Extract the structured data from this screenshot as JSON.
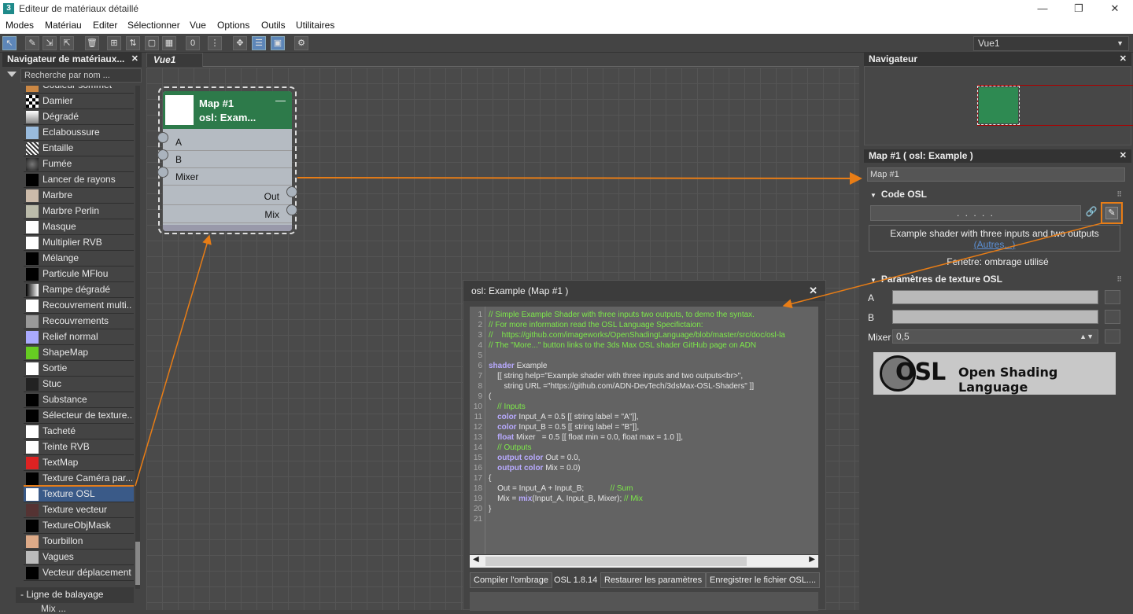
{
  "window": {
    "title": "Editeur de matériaux détaillé",
    "app_icon": "3",
    "controls": {
      "minimize": "—",
      "maximize": "❐",
      "close": "✕"
    }
  },
  "menu": [
    "Modes",
    "Matériau",
    "Editer",
    "Sélectionner",
    "Vue",
    "Options",
    "Outils",
    "Utilitaires"
  ],
  "toolbar": {
    "view_selector": "Vue1"
  },
  "left_panel": {
    "title": "Navigateur de matériaux...",
    "search_placeholder": "Recherche par nom ...",
    "items": [
      {
        "label": "Couleur sommet",
        "swatch": "#c84"
      },
      {
        "label": "Damier",
        "swatch": "checker"
      },
      {
        "label": "Dégradé",
        "swatch": "gradient"
      },
      {
        "label": "Eclaboussure",
        "swatch": "#9bd"
      },
      {
        "label": "Entaille",
        "swatch": "noise"
      },
      {
        "label": "Fumée",
        "swatch": "smoke"
      },
      {
        "label": "Lancer de rayons",
        "swatch": "#000"
      },
      {
        "label": "Marbre",
        "swatch": "#cba"
      },
      {
        "label": "Marbre Perlin",
        "swatch": "#bba"
      },
      {
        "label": "Masque",
        "swatch": "#fff"
      },
      {
        "label": "Multiplier RVB",
        "swatch": "#fff"
      },
      {
        "label": "Mélange",
        "swatch": "#000"
      },
      {
        "label": "Particule MFlou",
        "swatch": "#000"
      },
      {
        "label": "Rampe dégradé",
        "swatch": "ramp"
      },
      {
        "label": "Recouvrement multi...",
        "swatch": "#fff"
      },
      {
        "label": "Recouvrements",
        "swatch": "#999"
      },
      {
        "label": "Relief normal",
        "swatch": "#aaf"
      },
      {
        "label": "ShapeMap",
        "swatch": "#6c2"
      },
      {
        "label": "Sortie",
        "swatch": "#fff"
      },
      {
        "label": "Stuc",
        "swatch": "#222"
      },
      {
        "label": "Substance",
        "swatch": "#000"
      },
      {
        "label": "Sélecteur de texture...",
        "swatch": "#000"
      },
      {
        "label": "Tacheté",
        "swatch": "#fff"
      },
      {
        "label": "Teinte RVB",
        "swatch": "#fff"
      },
      {
        "label": "TextMap",
        "swatch": "#d22"
      },
      {
        "label": "Texture Caméra par...",
        "swatch": "#000"
      },
      {
        "label": "Texture OSL",
        "swatch": "#fff",
        "selected": true
      },
      {
        "label": "Texture vecteur",
        "swatch": "#533"
      },
      {
        "label": "TextureObjMask",
        "swatch": "#000"
      },
      {
        "label": "Tourbillon",
        "swatch": "#da8"
      },
      {
        "label": "Vagues",
        "swatch": "#bbb"
      },
      {
        "label": "Vecteur déplacement",
        "swatch": "#000"
      }
    ],
    "rollup": "- Ligne de balayage",
    "rollup_next": "Mix ..."
  },
  "view": {
    "tab": "Vue1"
  },
  "node": {
    "title1": "Map #1",
    "title2": "osl: Exam...",
    "minimize": "—",
    "inputs": [
      "A",
      "B",
      "Mixer"
    ],
    "outputs": [
      "Out",
      "Mix"
    ]
  },
  "navigator": {
    "title": "Navigateur",
    "close": "✕"
  },
  "map_panel": {
    "title": "Map #1  ( osl: Example )",
    "close": "✕",
    "name_field": "Map #1",
    "osl_section": "Code OSL",
    "dots_button": ". . . . .",
    "description": "Example shader with three inputs and two outputs",
    "more_link": "(Autres...)",
    "window_status": "Fenetre: ombrage utilisé",
    "params_section": "Paramètres de texture OSL",
    "params": [
      {
        "label": "A"
      },
      {
        "label": "B"
      }
    ],
    "mixer_label": "Mixer",
    "mixer_value": "0,5",
    "logo_text": "Open Shading Language",
    "logo_mark": "OSL"
  },
  "editor": {
    "title": "osl: Example (Map #1 )",
    "close": "✕",
    "line_numbers": [
      "1",
      "2",
      "3",
      "4",
      "5",
      "6",
      "7",
      "8",
      "9",
      "10",
      "11",
      "12",
      "13",
      "14",
      "15",
      "16",
      "17",
      "18",
      "19",
      "20",
      "21"
    ],
    "code": [
      [
        {
          "t": "// Simple Example Shader with three inputs two outputs, to demo the syntax.",
          "c": "cm"
        }
      ],
      [
        {
          "t": "// For more information read the OSL Language Specifictaion:",
          "c": "cm"
        }
      ],
      [
        {
          "t": "//    https://github.com/imageworks/OpenShadingLanguage/blob/master/src/doc/osl-la",
          "c": "cm"
        }
      ],
      [
        {
          "t": "// The \"More...\" button links to the 3ds Max OSL shader GitHub page on ADN",
          "c": "cm"
        }
      ],
      [
        {
          "t": "",
          "c": ""
        }
      ],
      [
        {
          "t": "shader",
          "c": "kw"
        },
        {
          "t": " Example",
          "c": ""
        }
      ],
      [
        {
          "t": "    [[ string help=\"Example shader with three inputs and two outputs<br>\",",
          "c": ""
        }
      ],
      [
        {
          "t": "       string URL =\"https://github.com/ADN-DevTech/3dsMax-OSL-Shaders\" ]]",
          "c": ""
        }
      ],
      [
        {
          "t": "(",
          "c": ""
        }
      ],
      [
        {
          "t": "    // Inputs",
          "c": "cm"
        }
      ],
      [
        {
          "t": "    ",
          "c": ""
        },
        {
          "t": "color",
          "c": "kw"
        },
        {
          "t": " Input_A = 0.5 [[ string label = \"A\"]],",
          "c": ""
        }
      ],
      [
        {
          "t": "    ",
          "c": ""
        },
        {
          "t": "color",
          "c": "kw"
        },
        {
          "t": " Input_B = 0.5 [[ string label = \"B\"]],",
          "c": ""
        }
      ],
      [
        {
          "t": "    ",
          "c": ""
        },
        {
          "t": "float",
          "c": "kw"
        },
        {
          "t": " Mixer   = 0.5 [[ float min = 0.0, float max = 1.0 ]],",
          "c": ""
        }
      ],
      [
        {
          "t": "    // Outputs",
          "c": "cm"
        }
      ],
      [
        {
          "t": "    ",
          "c": ""
        },
        {
          "t": "output color",
          "c": "kw"
        },
        {
          "t": " Out = 0.0,",
          "c": ""
        }
      ],
      [
        {
          "t": "    ",
          "c": ""
        },
        {
          "t": "output color",
          "c": "kw"
        },
        {
          "t": " Mix = 0.0)",
          "c": ""
        }
      ],
      [
        {
          "t": "{",
          "c": ""
        }
      ],
      [
        {
          "t": "    Out = Input_A + Input_B;            ",
          "c": ""
        },
        {
          "t": "// Sum",
          "c": "cm"
        }
      ],
      [
        {
          "t": "    Mix = ",
          "c": ""
        },
        {
          "t": "mix",
          "c": "kw"
        },
        {
          "t": "(Input_A, Input_B, Mixer); ",
          "c": ""
        },
        {
          "t": "// Mix",
          "c": "cm"
        }
      ],
      [
        {
          "t": "}",
          "c": ""
        }
      ],
      [
        {
          "t": "",
          "c": ""
        }
      ]
    ],
    "buttons": {
      "compile": "Compiler l'ombrage",
      "version": "OSL 1.8.14",
      "restore": "Restaurer les paramètres",
      "save": "Enregistrer le fichier OSL...."
    }
  },
  "colors": {
    "annotation": "#e87d16",
    "node_header": "#2d7a4a",
    "selection": "#3a5a88"
  }
}
